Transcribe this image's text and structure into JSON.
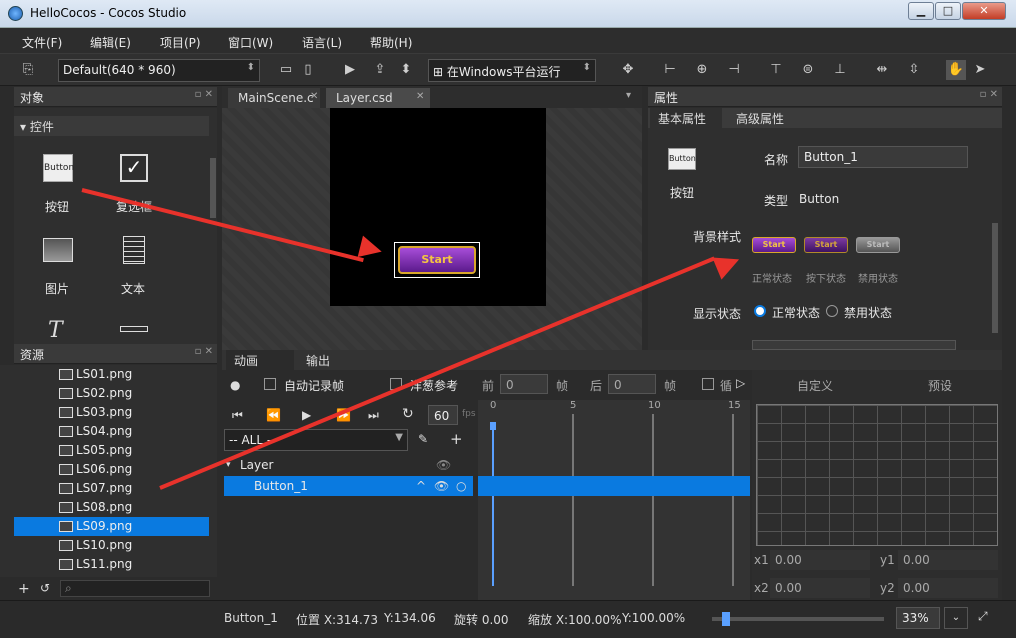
{
  "window": {
    "title": "HelloCocos - Cocos Studio",
    "min": "▁",
    "max": "□",
    "close": "✕"
  },
  "menu": [
    "文件(F)",
    "编辑(E)",
    "项目(P)",
    "窗口(W)",
    "语言(L)",
    "帮助(H)"
  ],
  "toolbar": {
    "resolution": "Default(640 * 960)",
    "run_target": "在Windows平台运行"
  },
  "objects_panel": {
    "title": "对象",
    "section": "控件",
    "items": [
      {
        "label": "按钮",
        "icon": "button-icon",
        "text": "Button"
      },
      {
        "label": "复选框",
        "icon": "checkbox-icon"
      },
      {
        "label": "图片",
        "icon": "image-icon"
      },
      {
        "label": "文本",
        "icon": "text-icon"
      }
    ]
  },
  "resources_panel": {
    "title": "资源",
    "files": [
      "LS01.png",
      "LS02.png",
      "LS03.png",
      "LS04.png",
      "LS05.png",
      "LS06.png",
      "LS07.png",
      "LS08.png",
      "LS09.png",
      "LS10.png",
      "LS11.png"
    ],
    "selected": "LS09.png"
  },
  "editor": {
    "tabs": [
      "MainScene.c",
      "Layer.csd"
    ],
    "active_tab": "Layer.csd",
    "button_text": "Start"
  },
  "properties": {
    "title": "属性",
    "tabs": [
      "基本属性",
      "高级属性"
    ],
    "widget_label": "按钮",
    "widget_icon_text": "Button",
    "name_label": "名称",
    "name_value": "Button_1",
    "type_label": "类型",
    "type_value": "Button",
    "bg_style_label": "背景样式",
    "states": [
      "正常状态",
      "按下状态",
      "禁用状态"
    ],
    "state_btn_text": "Start",
    "display_state_label": "显示状态",
    "display_options": [
      "正常状态",
      "禁用状态"
    ],
    "display_selected": "正常状态"
  },
  "animation": {
    "tabs": [
      "动画",
      "输出"
    ],
    "auto_record": "自动记录帧",
    "onion": "洋葱参考",
    "prev_label": "前",
    "prev_value": "0",
    "frame_unit": "帧",
    "next_label": "后",
    "next_value": "0",
    "loop_label": "循",
    "fps": "60",
    "fps_unit": "fps",
    "filter": "-- ALL --",
    "tree": {
      "layer": "Layer",
      "node": "Button_1"
    },
    "ticks": [
      "0",
      "5",
      "10",
      "15"
    ],
    "curve_tabs": [
      "自定义",
      "预设"
    ],
    "x1": "0.00",
    "y1": "0.00",
    "x2": "0.00",
    "y2": "0.00"
  },
  "status": {
    "name": "Button_1",
    "pos_label": "位置 X:314.73",
    "pos_y": "Y:134.06",
    "rotation": "旋转 0.00",
    "scale": "缩放 X:100.00%",
    "scale_y": "Y:100.00%",
    "zoom": "33%"
  }
}
